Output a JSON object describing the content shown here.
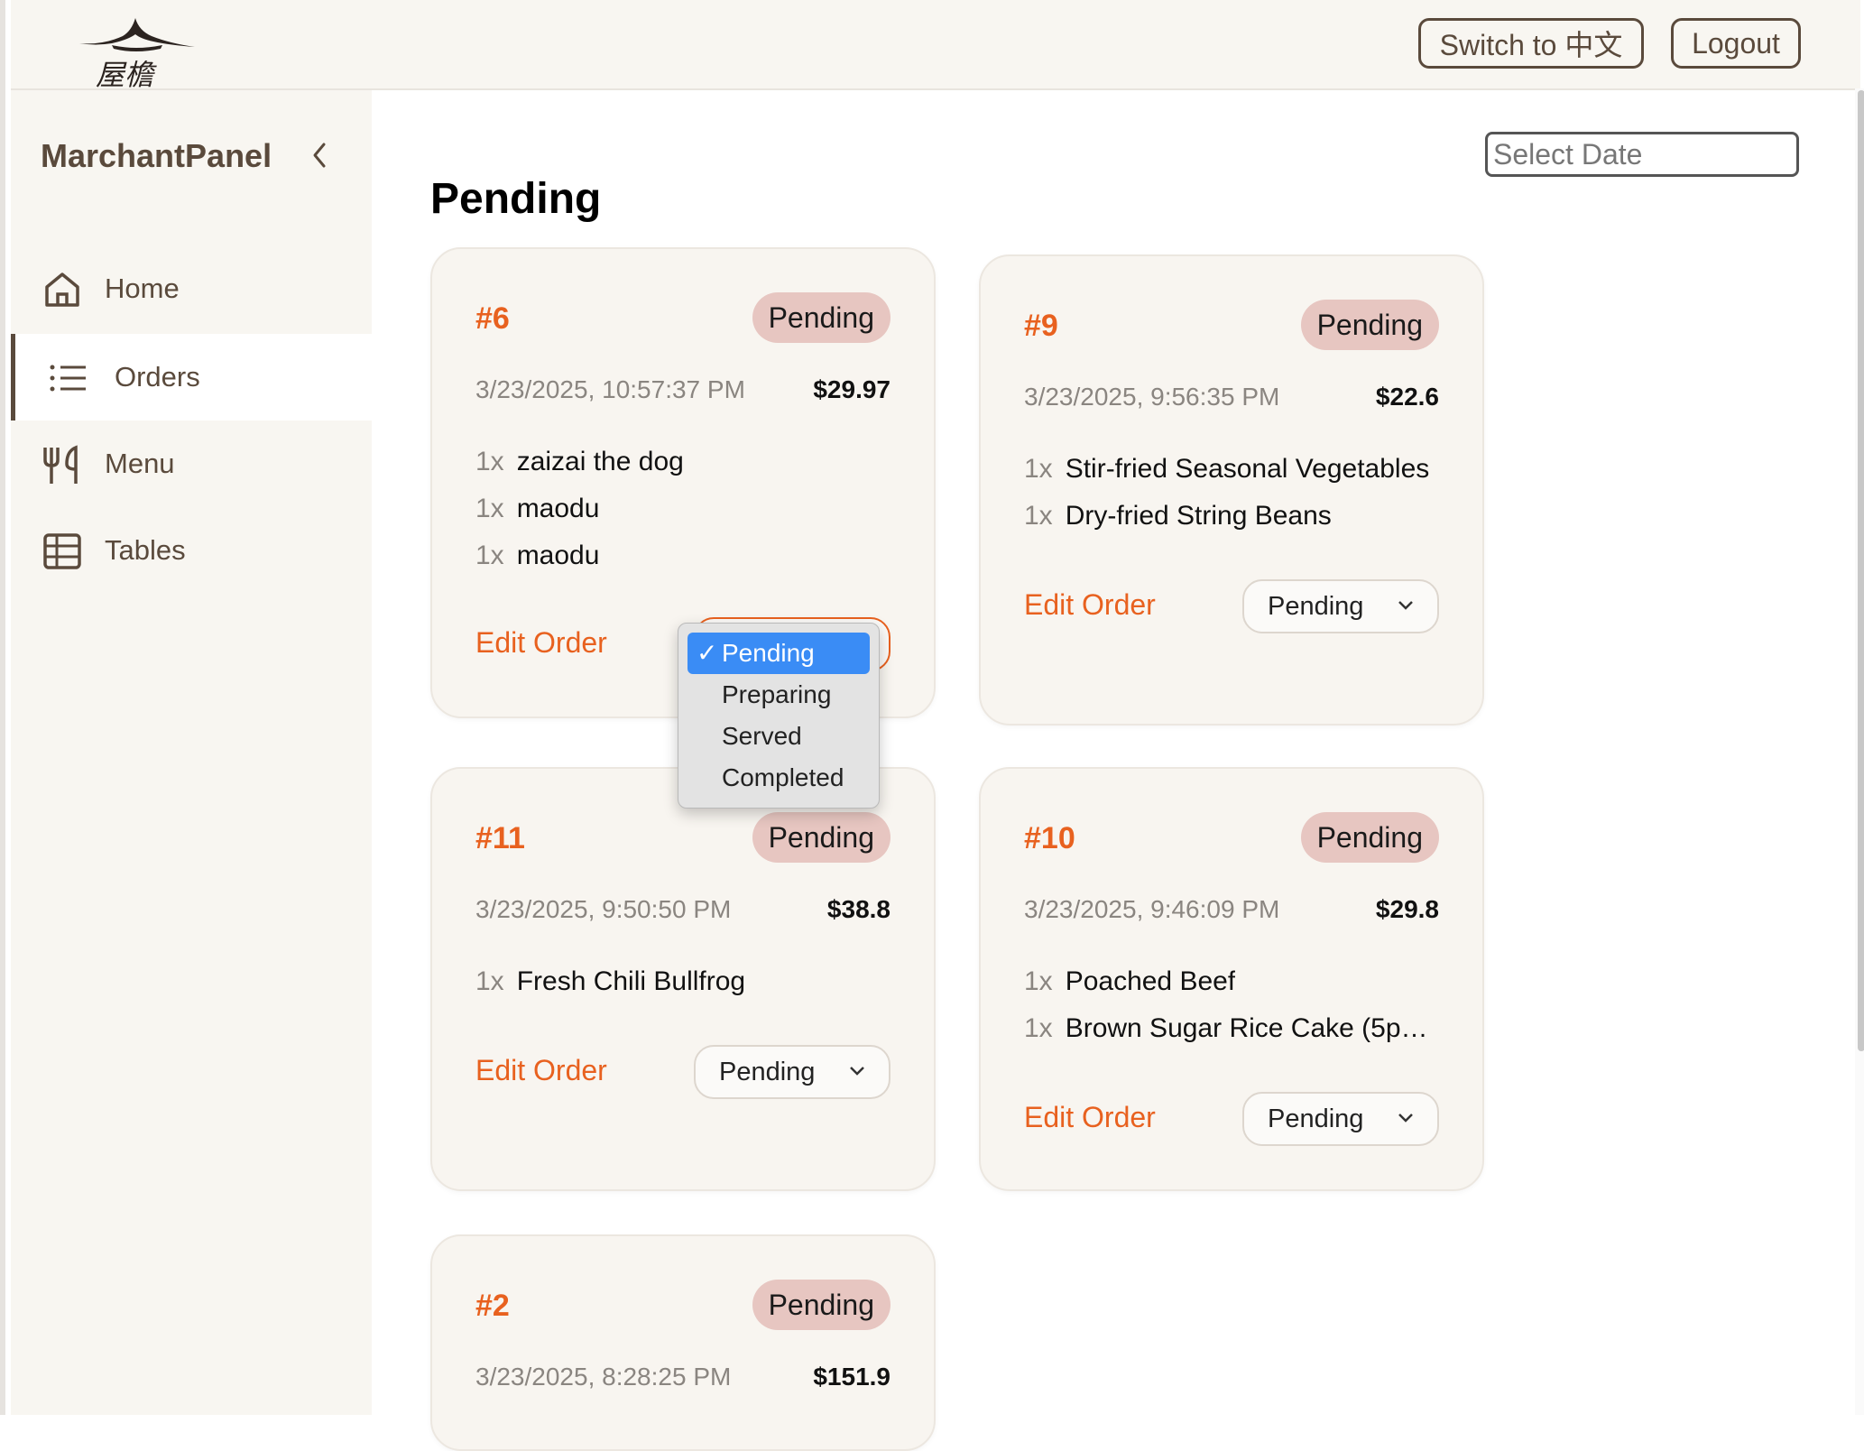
{
  "header": {
    "switch_label": "Switch to 中文",
    "logout_label": "Logout"
  },
  "sidebar": {
    "brand": "MarchantPanel",
    "items": [
      {
        "label": "Home",
        "icon": "home-icon"
      },
      {
        "label": "Orders",
        "icon": "list-icon",
        "active": true
      },
      {
        "label": "Menu",
        "icon": "utensils-icon"
      },
      {
        "label": "Tables",
        "icon": "table-icon"
      }
    ]
  },
  "main": {
    "title": "Pending",
    "date_placeholder": "Select Date",
    "edit_label": "Edit Order",
    "orders": [
      {
        "id": "#6",
        "badge": "Pending",
        "datetime": "3/23/2025, 10:57:37 PM",
        "total": "$29.97",
        "items": [
          {
            "qty": "1x",
            "name": "zaizai the dog"
          },
          {
            "qty": "1x",
            "name": "maodu"
          },
          {
            "qty": "1x",
            "name": "maodu"
          }
        ],
        "status": "Pending"
      },
      {
        "id": "#9",
        "badge": "Pending",
        "datetime": "3/23/2025, 9:56:35 PM",
        "total": "$22.6",
        "items": [
          {
            "qty": "1x",
            "name": "Stir-fried Seasonal Vegetables"
          },
          {
            "qty": "1x",
            "name": "Dry-fried String Beans"
          }
        ],
        "status": "Pending"
      },
      {
        "id": "#11",
        "badge": "Pending",
        "datetime": "3/23/2025, 9:50:50 PM",
        "total": "$38.8",
        "items": [
          {
            "qty": "1x",
            "name": "Fresh Chili Bullfrog"
          }
        ],
        "status": "Pending"
      },
      {
        "id": "#10",
        "badge": "Pending",
        "datetime": "3/23/2025, 9:46:09 PM",
        "total": "$29.8",
        "items": [
          {
            "qty": "1x",
            "name": "Poached Beef"
          },
          {
            "qty": "1x",
            "name": "Brown Sugar Rice Cake (5p…"
          }
        ],
        "status": "Pending"
      },
      {
        "id": "#2",
        "badge": "Pending",
        "datetime": "3/23/2025, 8:28:25 PM",
        "total": "$151.9"
      }
    ],
    "dropdown": {
      "check": "✓",
      "options": [
        "Pending",
        "Preparing",
        "Served",
        "Completed"
      ],
      "selected": "Pending"
    }
  },
  "colors": {
    "accent": "#e8611f",
    "brown": "#5a4a3c",
    "badge_bg": "#e7c6c1",
    "card_bg": "#f8f5f0",
    "select_highlight": "#3a8cf5"
  }
}
